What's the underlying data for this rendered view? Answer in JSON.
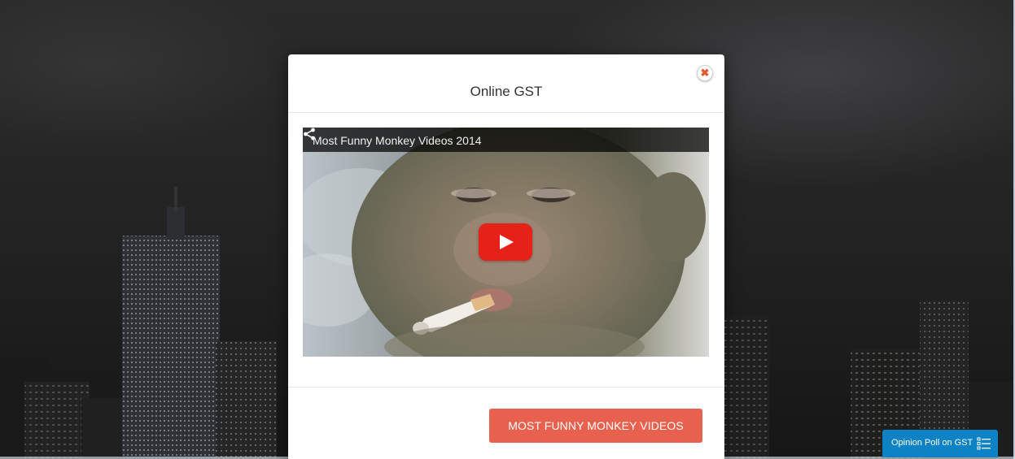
{
  "modal": {
    "title": "Online GST",
    "close_symbol": "✖",
    "video": {
      "title": "Most Funny Monkey Videos 2014",
      "share_icon": "share-icon",
      "play_icon": "youtube-play-icon"
    },
    "cta_label": "MOST FUNNY MONKEY VIDEOS"
  },
  "poll_tab": {
    "label": "Opinion Poll on GST",
    "icon": "list-icon"
  },
  "colors": {
    "cta": "#e8614e",
    "poll_tab": "#0d82c4",
    "play_button": "#e62117",
    "close": "#e25a2c"
  }
}
